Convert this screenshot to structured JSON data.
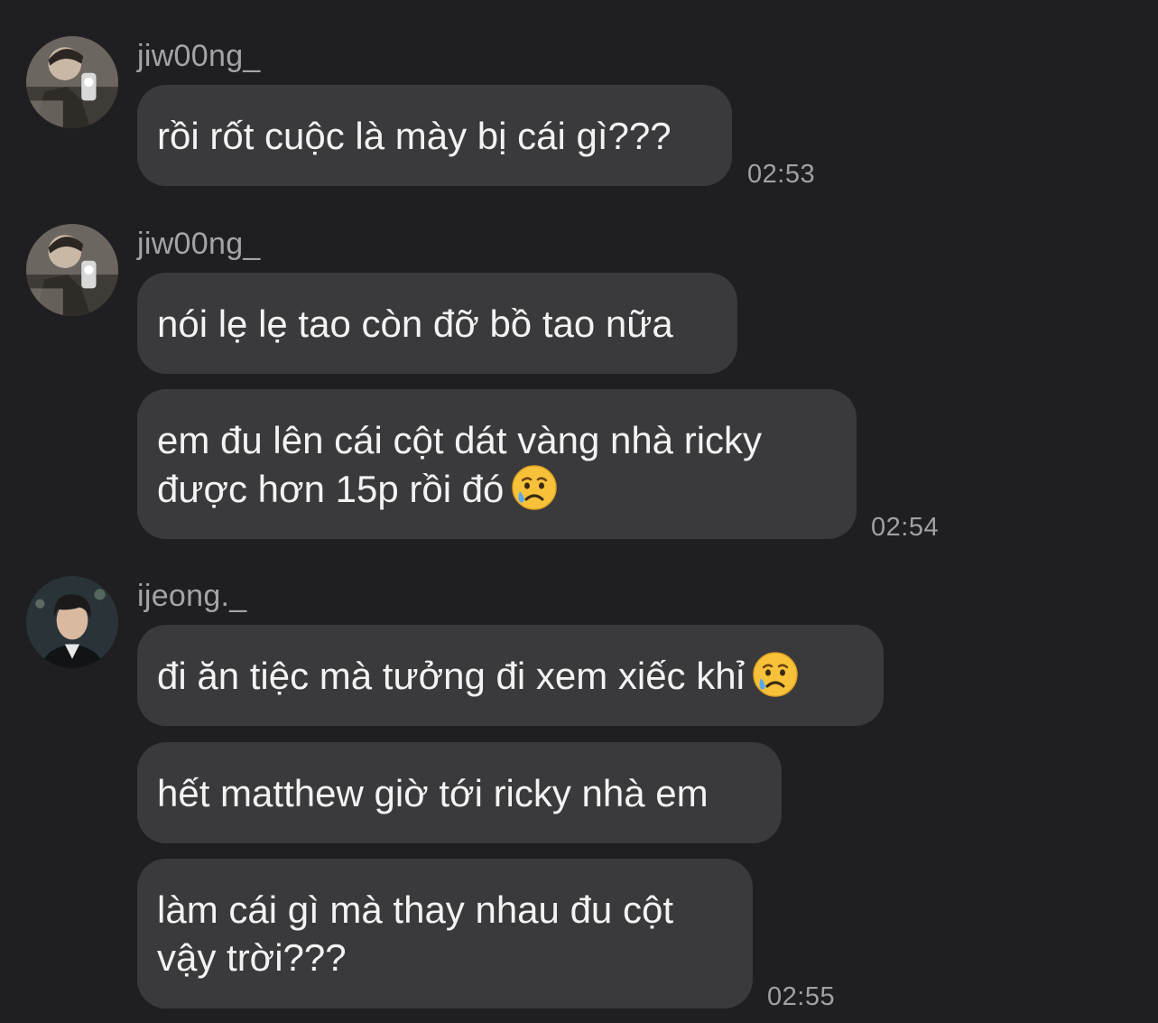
{
  "messages": {
    "g1": {
      "username": "jiw00ng_",
      "b1": "rồi rốt cuộc là mày bị cái gì???",
      "time": "02:53"
    },
    "g2": {
      "username": "jiw00ng_",
      "b1": "nói lẹ lẹ tao còn đỡ bồ tao nữa",
      "b2": "em đu lên cái cột dát vàng nhà ricky\nđược hơn 15p rồi đó",
      "time": "02:54"
    },
    "g3": {
      "username": "ijeong._",
      "b1": "đi ăn tiệc mà tưởng đi xem xiếc khỉ",
      "b2": "hết matthew giờ tới ricky nhà em",
      "b3": "làm cái gì mà thay nhau đu cột\nvậy trời???",
      "time": "02:55"
    }
  },
  "icons": {
    "emoji": "crying-face-emoji",
    "avatar1": "user-avatar-photo",
    "avatar2": "user-avatar-photo"
  }
}
